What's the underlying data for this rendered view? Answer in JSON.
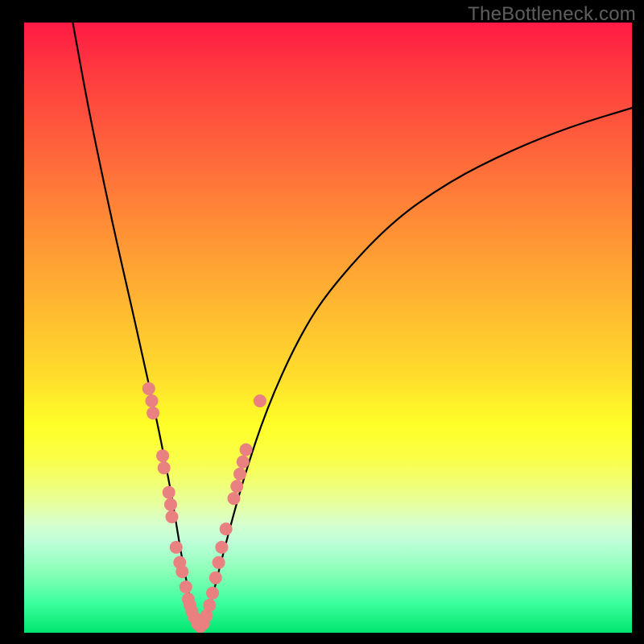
{
  "watermark": "TheBottleneck.com",
  "colors": {
    "frame": "#000000",
    "curve_stroke": "#000000",
    "dot_fill": "#e98181",
    "gradient_top": "#ff1a44",
    "gradient_bottom": "#00e66e"
  },
  "chart_data": {
    "type": "line",
    "title": "",
    "xlabel": "",
    "ylabel": "",
    "xlim": [
      0,
      100
    ],
    "ylim": [
      0,
      100
    ],
    "description": "V-shaped bottleneck curve on rainbow gradient background; minimum near x≈28 at y≈0, steep left descent and shallower right ascent.",
    "series": [
      {
        "name": "bottleneck-curve",
        "x": [
          8,
          10,
          12,
          15,
          18,
          20,
          22,
          24,
          25,
          26,
          27,
          28,
          29,
          30,
          31,
          33,
          36,
          40,
          45,
          50,
          60,
          70,
          80,
          90,
          100
        ],
        "y": [
          100,
          89,
          79,
          65,
          52,
          43,
          34,
          24,
          18,
          12,
          7,
          2,
          0,
          2,
          6,
          14,
          25,
          37,
          48,
          56,
          67,
          74,
          79,
          83,
          86
        ]
      }
    ],
    "highlight_dots": {
      "name": "pink-dots",
      "points": [
        {
          "x": 20.5,
          "y": 40
        },
        {
          "x": 21.0,
          "y": 38
        },
        {
          "x": 21.2,
          "y": 36
        },
        {
          "x": 22.8,
          "y": 29
        },
        {
          "x": 23.0,
          "y": 27
        },
        {
          "x": 23.8,
          "y": 23
        },
        {
          "x": 24.1,
          "y": 21
        },
        {
          "x": 24.3,
          "y": 19
        },
        {
          "x": 25.0,
          "y": 14
        },
        {
          "x": 25.6,
          "y": 11.5
        },
        {
          "x": 26.0,
          "y": 10
        },
        {
          "x": 26.6,
          "y": 7.5
        },
        {
          "x": 27.0,
          "y": 5.5
        },
        {
          "x": 27.3,
          "y": 4.5
        },
        {
          "x": 27.6,
          "y": 3.5
        },
        {
          "x": 28.0,
          "y": 2.5
        },
        {
          "x": 28.5,
          "y": 1.5
        },
        {
          "x": 29.0,
          "y": 1.0
        },
        {
          "x": 29.5,
          "y": 1.5
        },
        {
          "x": 30.0,
          "y": 2.8
        },
        {
          "x": 30.5,
          "y": 4.5
        },
        {
          "x": 31.0,
          "y": 6.5
        },
        {
          "x": 31.5,
          "y": 9
        },
        {
          "x": 32.0,
          "y": 11.5
        },
        {
          "x": 32.5,
          "y": 14
        },
        {
          "x": 33.2,
          "y": 17
        },
        {
          "x": 34.5,
          "y": 22
        },
        {
          "x": 35.0,
          "y": 24
        },
        {
          "x": 35.5,
          "y": 26
        },
        {
          "x": 36.0,
          "y": 28
        },
        {
          "x": 36.5,
          "y": 30
        },
        {
          "x": 38.8,
          "y": 38
        }
      ]
    }
  }
}
